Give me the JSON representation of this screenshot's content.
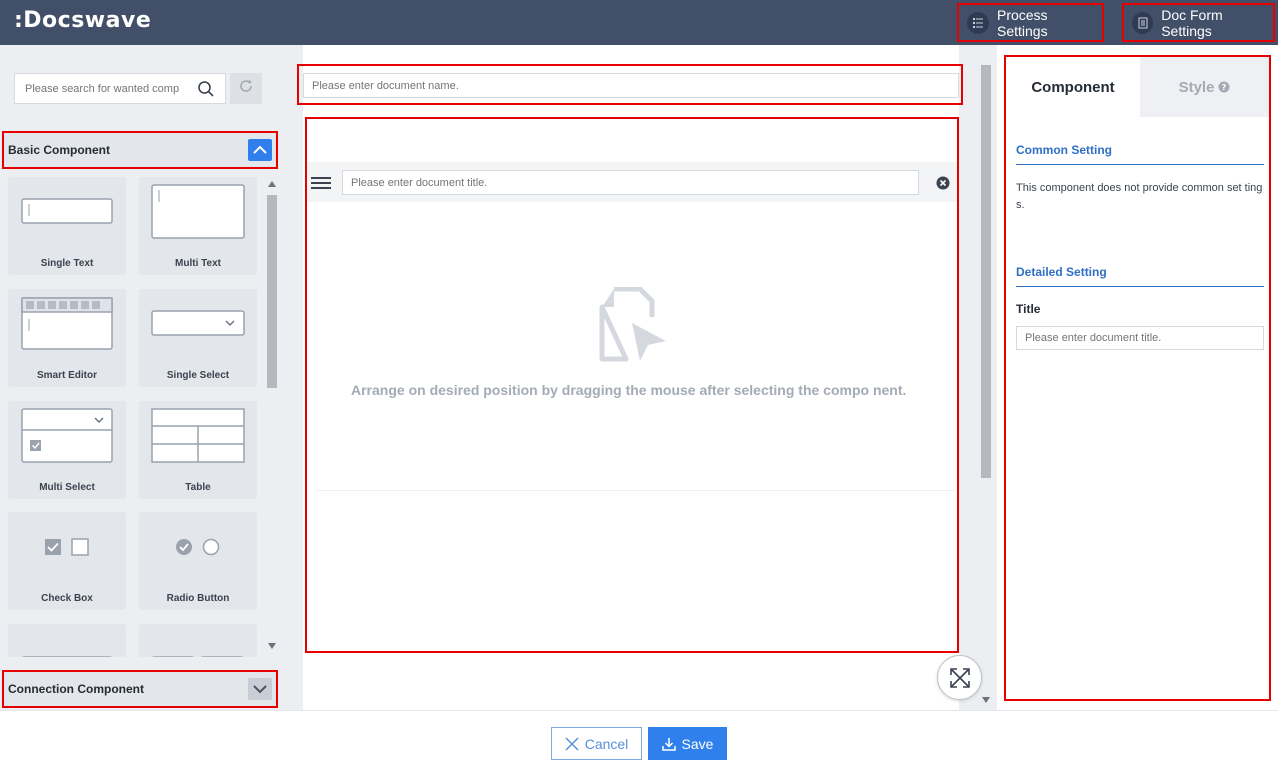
{
  "app": {
    "logo": ":Docswave"
  },
  "header": {
    "process_settings": "Process Settings",
    "doc_form_settings": "Doc Form Settings"
  },
  "left": {
    "search_placeholder": "Please search for wanted comp",
    "basic_section": "Basic Component",
    "connection_section": "Connection Component",
    "components": [
      {
        "label": "Single Text",
        "icon": "single-text-icon"
      },
      {
        "label": "Multi Text",
        "icon": "multi-text-icon"
      },
      {
        "label": "Smart Editor",
        "icon": "smart-editor-icon"
      },
      {
        "label": "Single Select",
        "icon": "single-select-icon"
      },
      {
        "label": "Multi Select",
        "icon": "multi-select-icon"
      },
      {
        "label": "Table",
        "icon": "table-icon"
      },
      {
        "label": "Check Box",
        "icon": "check-box-icon"
      },
      {
        "label": "Radio Button",
        "icon": "radio-button-icon"
      }
    ]
  },
  "center": {
    "doc_name_placeholder": "Please enter document name.",
    "doc_title_placeholder": "Please enter document title.",
    "empty_message": "Arrange on desired position by dragging the mouse after selecting the compo nent."
  },
  "right": {
    "tab_component": "Component",
    "tab_style": "Style",
    "common_setting_title": "Common Setting",
    "common_setting_text": "This component does not provide common set tings.",
    "detailed_setting_title": "Detailed Setting",
    "title_label": "Title",
    "title_placeholder": "Please enter document title."
  },
  "footer": {
    "cancel": "Cancel",
    "save": "Save"
  },
  "colors": {
    "header_bg": "#414f69",
    "accent": "#2f80ed",
    "highlight": "#e60000",
    "section_blue": "#2f6fc6"
  }
}
